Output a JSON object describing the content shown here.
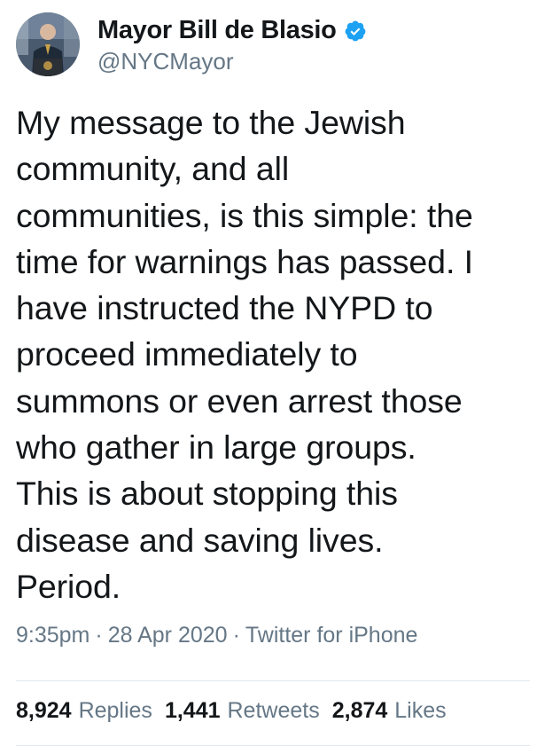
{
  "author": {
    "display_name": "Mayor Bill de Blasio",
    "handle": "@NYCMayor",
    "verified_icon": "verified-badge-icon",
    "verified_color": "#1da1f2"
  },
  "tweet": {
    "text": "My message to the Jewish\ncommunity, and all\ncommunities, is this simple: the\ntime for warnings has passed. I\nhave instructed the NYPD to\nproceed immediately to\nsummons or even arrest those\nwho gather in large groups.\nThis is about stopping this\ndisease and saving lives.\nPeriod."
  },
  "meta": {
    "time": "9:35pm",
    "separator": "·",
    "date": "28 Apr 2020",
    "source": "Twitter for iPhone"
  },
  "stats": {
    "replies_count": "8,924",
    "replies_label": "Replies",
    "retweets_count": "1,441",
    "retweets_label": "Retweets",
    "likes_count": "2,874",
    "likes_label": "Likes"
  },
  "colors": {
    "text_primary": "#14171a",
    "text_secondary": "#657786",
    "divider": "#e1e8ed"
  }
}
